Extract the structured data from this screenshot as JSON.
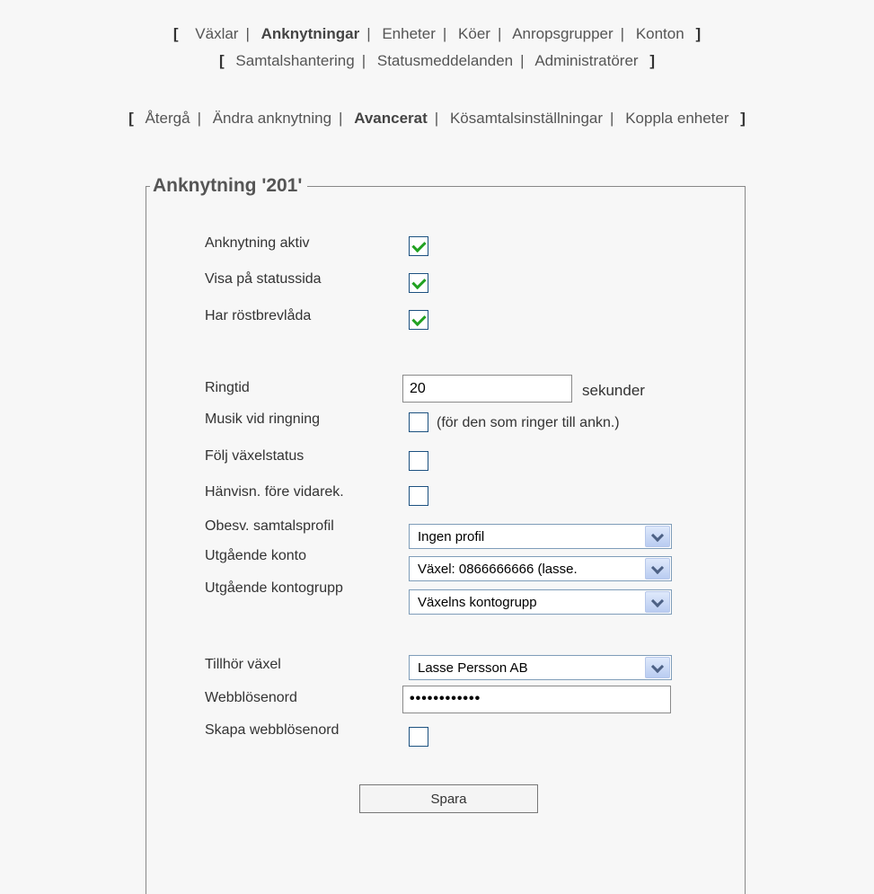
{
  "nav_primary": {
    "row1": [
      "Växlar",
      "Anknytningar",
      "Enheter",
      "Köer",
      "Anropsgrupper",
      "Konton"
    ],
    "row2": [
      "Samtalshantering",
      "Statusmeddelanden",
      "Administratörer"
    ]
  },
  "nav_secondary": [
    "Återgå",
    "Ändra anknytning",
    "Avancerat",
    "Kösamtalsinställningar",
    "Koppla enheter"
  ],
  "brackets": {
    "open": "[",
    "close": "]",
    "sep": "|"
  },
  "form": {
    "legend": "Anknytning '201'",
    "active_label": "Anknytning aktiv",
    "status_page_label": "Visa på statussida",
    "voicemail_label": "Har röstbrevlåda",
    "ringtime_label": "Ringtid",
    "ringtime_value": "20",
    "ringtime_unit": "sekunder",
    "music_label": "Musik vid ringning",
    "music_note": "(för den som ringer till ankn.)",
    "follow_label": "Följ växelstatus",
    "referral_label": "Hänvisn. före vidarek.",
    "unanswered_label": "Obesv. samtalsprofil",
    "unanswered_value": "Ingen profil",
    "outgoing_account_label": "Utgående konto",
    "outgoing_account_value": "Växel: 0866666666 (lasse.",
    "outgoing_group_label": "Utgående kontogrupp",
    "outgoing_group_value": "Växelns kontogrupp",
    "belongs_label": "Tillhör växel",
    "belongs_value": "Lasse Persson AB",
    "webpass_label": "Webblösenord",
    "webpass_value": "••••••••••••",
    "create_webpass_label": "Skapa webblösenord",
    "save_label": "Spara"
  },
  "checkbox_states": {
    "active": true,
    "status_page": true,
    "voicemail": true,
    "music": false,
    "follow": false,
    "referral": false,
    "create_webpass": false
  },
  "colors": {
    "checkmark": "#21a121",
    "background": "#f7f7f7"
  }
}
